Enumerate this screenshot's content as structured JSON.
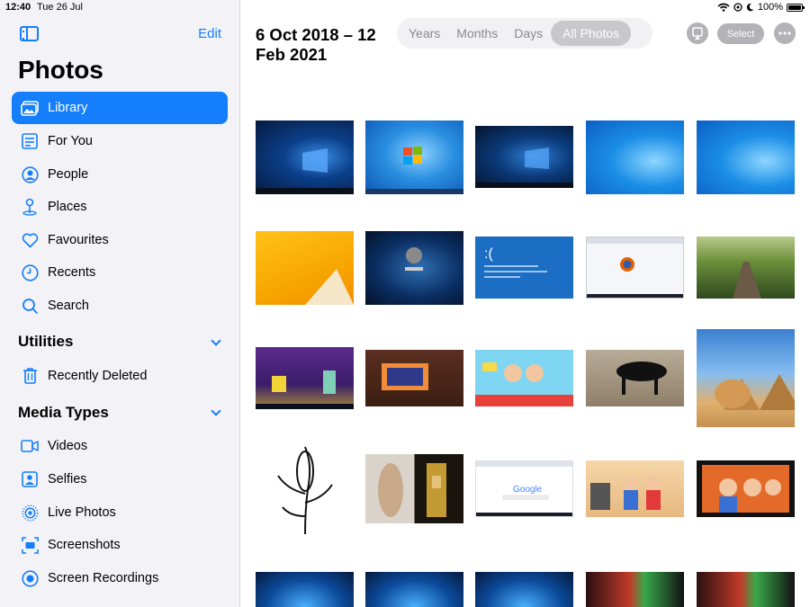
{
  "status": {
    "time": "12:40",
    "date": "Tue 26 Jul",
    "battery": "100%"
  },
  "sidebar": {
    "edit": "Edit",
    "title": "Photos",
    "items": [
      {
        "label": "Library",
        "icon": "library-icon",
        "active": true
      },
      {
        "label": "For You",
        "icon": "for-you-icon"
      },
      {
        "label": "People",
        "icon": "people-icon"
      },
      {
        "label": "Places",
        "icon": "places-icon"
      },
      {
        "label": "Favourites",
        "icon": "heart-icon"
      },
      {
        "label": "Recents",
        "icon": "clock-icon"
      },
      {
        "label": "Search",
        "icon": "search-icon"
      }
    ],
    "utilities": {
      "title": "Utilities",
      "items": [
        {
          "label": "Recently Deleted",
          "icon": "trash-icon"
        }
      ]
    },
    "media_types": {
      "title": "Media Types",
      "items": [
        {
          "label": "Videos",
          "icon": "video-icon"
        },
        {
          "label": "Selfies",
          "icon": "selfie-icon"
        },
        {
          "label": "Live Photos",
          "icon": "live-photo-icon"
        },
        {
          "label": "Screenshots",
          "icon": "screenshot-icon"
        },
        {
          "label": "Screen Recordings",
          "icon": "screen-recording-icon"
        }
      ]
    }
  },
  "header": {
    "date_range": "6 Oct 2018 – 12 Feb 2021",
    "segments": [
      "Years",
      "Months",
      "Days",
      "All Photos"
    ],
    "selected_segment": "All Photos",
    "select": "Select"
  },
  "accent": "#147efb"
}
